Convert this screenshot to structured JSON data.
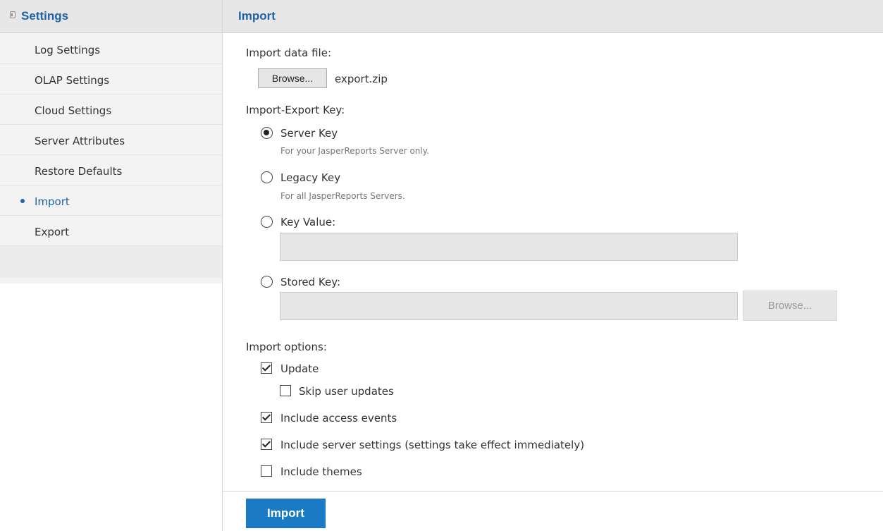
{
  "sidebar": {
    "title": "Settings",
    "items": [
      {
        "label": "Log Settings"
      },
      {
        "label": "OLAP Settings"
      },
      {
        "label": "Cloud Settings"
      },
      {
        "label": "Server Attributes"
      },
      {
        "label": "Restore Defaults"
      },
      {
        "label": "Import",
        "active": true
      },
      {
        "label": "Export"
      }
    ]
  },
  "main": {
    "title": "Import",
    "import_file_label": "Import data file:",
    "browse_label": "Browse...",
    "file_name": "export.zip",
    "key_section_label": "Import-Export Key:",
    "keys": [
      {
        "label": "Server Key",
        "hint": "For your JasperReports Server only.",
        "selected": true
      },
      {
        "label": "Legacy Key",
        "hint": "For all JasperReports Servers.",
        "selected": false
      },
      {
        "label": "Key Value:",
        "hint": "",
        "selected": false
      },
      {
        "label": "Stored Key:",
        "hint": "",
        "selected": false
      }
    ],
    "stored_key_browse_label": "Browse...",
    "options_label": "Import options:",
    "options": [
      {
        "label": "Update",
        "checked": true
      },
      {
        "label": "Skip user updates",
        "checked": false
      },
      {
        "label": "Include access events",
        "checked": true
      },
      {
        "label": "Include server settings (settings take effect immediately)",
        "checked": true
      },
      {
        "label": "Include themes",
        "checked": false
      }
    ],
    "submit_label": "Import"
  },
  "colors": {
    "accent": "#1f63a7",
    "button": "#1a7bc4"
  }
}
